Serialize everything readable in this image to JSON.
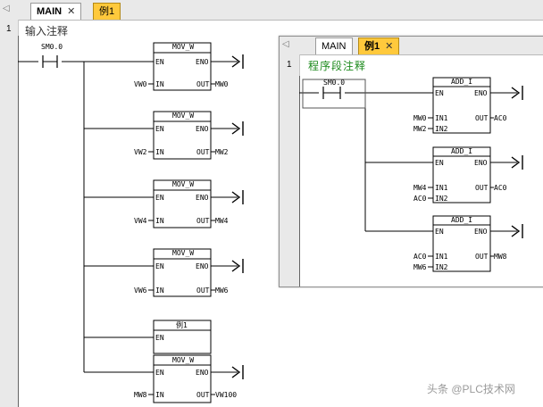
{
  "editor": {
    "tabs": [
      {
        "label": "MAIN",
        "close": "✕"
      },
      {
        "label": "例1"
      }
    ],
    "network_number": "1",
    "comment": "输入注释",
    "contact": "SM0.0",
    "blocks": [
      {
        "name": "MOV_W",
        "en": "EN",
        "eno": "ENO",
        "in_pin": "IN",
        "out_pin": "OUT",
        "in_val": "VW0",
        "out_val": "MW0"
      },
      {
        "name": "MOV_W",
        "en": "EN",
        "eno": "ENO",
        "in_pin": "IN",
        "out_pin": "OUT",
        "in_val": "VW2",
        "out_val": "MW2"
      },
      {
        "name": "MOV_W",
        "en": "EN",
        "eno": "ENO",
        "in_pin": "IN",
        "out_pin": "OUT",
        "in_val": "VW4",
        "out_val": "MW4"
      },
      {
        "name": "MOV_W",
        "en": "EN",
        "eno": "ENO",
        "in_pin": "IN",
        "out_pin": "OUT",
        "in_val": "VW6",
        "out_val": "MW6"
      },
      {
        "name": "例1",
        "en": "EN"
      },
      {
        "name": "MOV_W",
        "en": "EN",
        "eno": "ENO",
        "in_pin": "IN",
        "out_pin": "OUT",
        "in_val": "MW8",
        "out_val": "VW100"
      }
    ]
  },
  "subroutine": {
    "tabs": [
      {
        "label": "MAIN"
      },
      {
        "label": "例1",
        "close": "✕"
      }
    ],
    "network_number": "1",
    "comment": "程序段注释",
    "contact": "SM0.0",
    "blocks": [
      {
        "name": "ADD_I",
        "en": "EN",
        "eno": "ENO",
        "in1_pin": "IN1",
        "in2_pin": "IN2",
        "out_pin": "OUT",
        "in1_val": "MW0",
        "in2_val": "MW2",
        "out_val": "AC0"
      },
      {
        "name": "ADD_I",
        "en": "EN",
        "eno": "ENO",
        "in1_pin": "IN1",
        "in2_pin": "IN2",
        "out_pin": "OUT",
        "in1_val": "MW4",
        "in2_val": "AC0",
        "out_val": "AC0"
      },
      {
        "name": "ADD_I",
        "en": "EN",
        "eno": "ENO",
        "in1_pin": "IN1",
        "in2_pin": "IN2",
        "out_pin": "OUT",
        "in1_val": "AC0",
        "in2_val": "MW6",
        "out_val": "MW8"
      }
    ]
  },
  "watermark": "头条 @PLC技术网",
  "colors": {
    "active_tab": "#ffc93c",
    "comment2": "#1c8a1c"
  }
}
